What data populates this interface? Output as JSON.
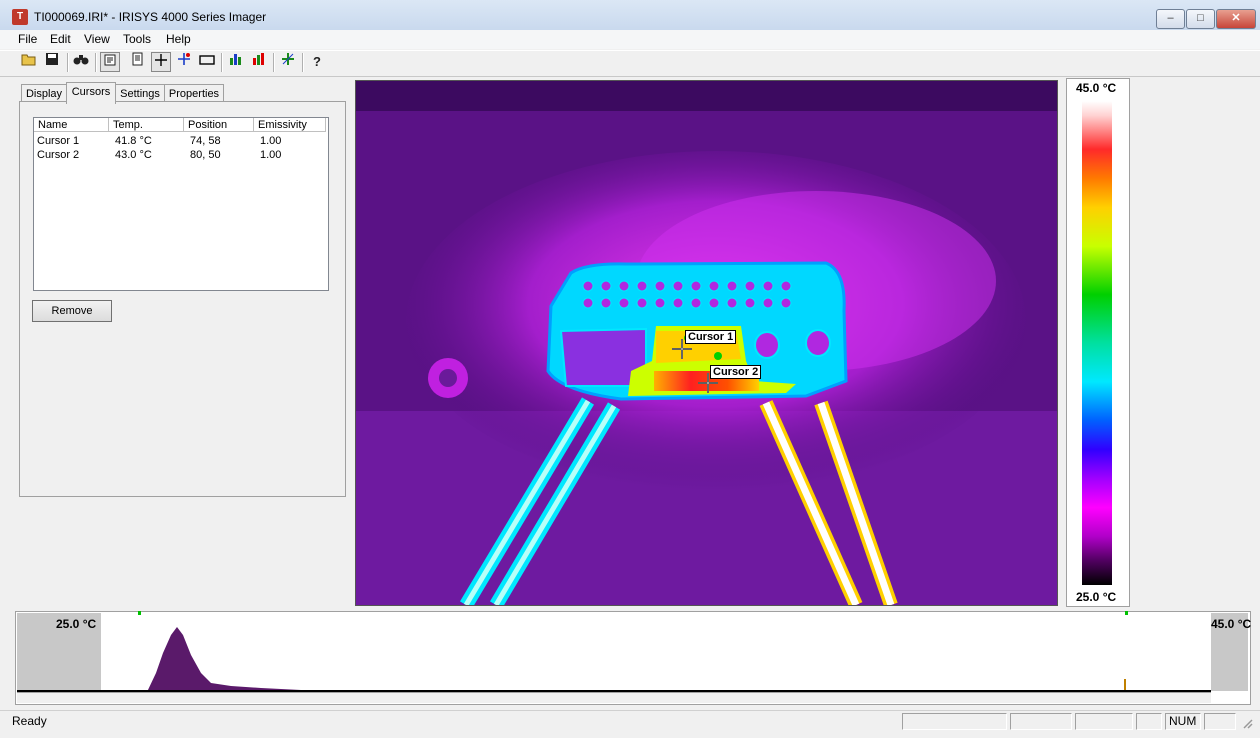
{
  "window": {
    "title": "TI000069.IRI* - IRISYS 4000 Series Imager",
    "app_icon": "thermal-imager-app-icon",
    "controls": [
      "minimize-icon",
      "maximize-icon",
      "close-icon"
    ]
  },
  "menu": [
    "File",
    "Edit",
    "View",
    "Tools",
    "Help"
  ],
  "toolbar": {
    "icons": [
      "open-folder-icon",
      "save-icon",
      "binoculars-icon",
      "properties-icon",
      "report-icon",
      "crosshair-icon",
      "add-cursor-icon",
      "rectangle-icon",
      "histogram-icon",
      "histogram-color-icon",
      "calibrate-icon",
      "help-icon"
    ]
  },
  "tabs": [
    "Display",
    "Cursors",
    "Settings",
    "Properties"
  ],
  "active_tab": "Cursors",
  "cursor_table": {
    "columns": [
      "Name",
      "Temp.",
      "Position",
      "Emissivity"
    ],
    "rows": [
      {
        "name": "Cursor 1",
        "temp": "41.8 °C",
        "position": "74, 58",
        "emissivity": "1.00"
      },
      {
        "name": "Cursor 2",
        "temp": "43.0 °C",
        "position": "80, 50",
        "emissivity": "1.00"
      }
    ]
  },
  "remove_button": "Remove",
  "image": {
    "cursor1_label": "Cursor 1",
    "cursor2_label": "Cursor 2"
  },
  "scale": {
    "max": "45.0 °C",
    "min": "25.0 °C",
    "colors": [
      "#ffffff",
      "#ff2a2a",
      "#ffd000",
      "#00d000",
      "#00e8ff",
      "#0060ff",
      "#ff00ff",
      "#000000"
    ]
  },
  "histogram": {
    "min": "25.0 °C",
    "max": "45.0 °C"
  },
  "status": {
    "text": "Ready",
    "num": "NUM"
  }
}
